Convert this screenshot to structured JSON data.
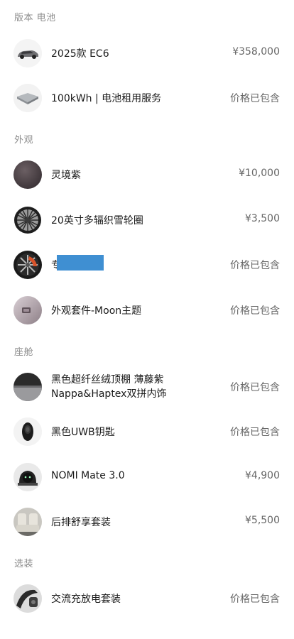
{
  "sections": {
    "version_battery": "版本 电池",
    "exterior": "外观",
    "cabin": "座舱",
    "options": "选装"
  },
  "items": {
    "model": {
      "label": "2025款 EC6",
      "price": "¥358,000"
    },
    "battery": {
      "label": "100kWh | 电池租用服务",
      "price": "价格已包含"
    },
    "color": {
      "label": "灵境紫",
      "price": "¥10,000"
    },
    "wheels": {
      "label": "20英寸多辐织雪轮圈",
      "price": "¥3,500"
    },
    "redacted": {
      "label": "专",
      "price": "价格已包含"
    },
    "exterior_kit": {
      "label": "外观套件-Moon主题",
      "price": "价格已包含"
    },
    "interior": {
      "label_line1": "黑色超纤丝绒顶棚 薄藤紫",
      "label_line2": "Nappa&Haptex双拼内饰",
      "price": "价格已包含"
    },
    "key": {
      "label": "黑色UWB钥匙",
      "price": "价格已包含"
    },
    "nomi": {
      "label": "NOMI Mate 3.0",
      "price": "¥4,900"
    },
    "rear_comfort": {
      "label": "后排舒享套装",
      "price": "¥5,500"
    },
    "charging": {
      "label": "交流充放电套装",
      "price": "价格已包含"
    }
  }
}
